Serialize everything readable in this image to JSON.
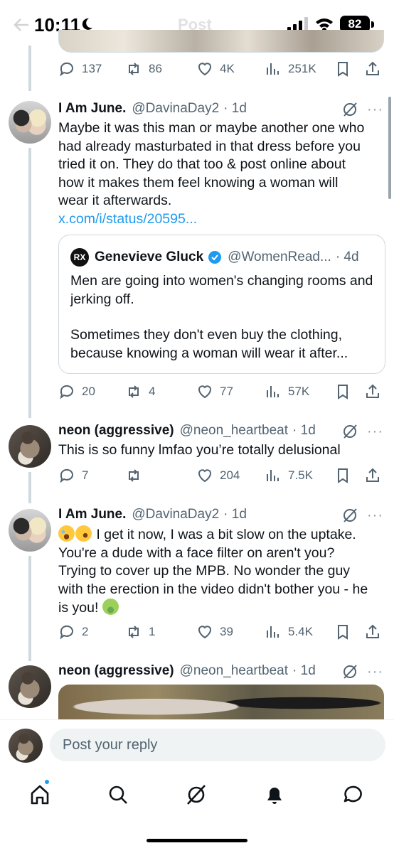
{
  "status_bar": {
    "time": "10:11",
    "battery": "82",
    "ghost_title": "Post"
  },
  "top_tweet_actions": {
    "replies": "137",
    "reposts": "86",
    "likes": "4K",
    "views": "251K"
  },
  "tweets": [
    {
      "name": "I Am June.",
      "handle": "@DavinaDay2",
      "time": "· 1d",
      "text": "Maybe it was this man or maybe another one who had already masturbated in that dress before you tried it on. They do that too & post online about how it makes them feel knowing a woman will wear it afterwards.",
      "link": "x.com/i/status/20595...",
      "quote": {
        "logo": "RX",
        "name": "Genevieve Gluck",
        "handle": "@WomenRead...",
        "time": "· 4d",
        "text1": "Men are going into women's changing rooms and jerking off.",
        "text2": "Sometimes they don't even buy the clothing, because knowing a woman will wear it after..."
      },
      "actions": {
        "replies": "20",
        "reposts": "4",
        "likes": "77",
        "views": "57K"
      }
    },
    {
      "name": "neon (aggressive)",
      "handle": "@neon_heartbeat",
      "time": "· 1d",
      "text": "This is so funny lmfao you’re totally delusional",
      "actions": {
        "replies": "7",
        "reposts": "",
        "likes": "204",
        "views": "7.5K"
      }
    },
    {
      "name": "I Am June.",
      "handle": "@DavinaDay2",
      "time": "· 1d",
      "text_a": " I get it now, I was a bit slow on the uptake. You're a dude with a face filter on aren't you? Trying to cover up the MPB. No wonder the guy with the erection in the video didn't bother you - he is you! ",
      "emojis": [
        "joy-emoji",
        "rofl-emoji",
        "nauseated-emoji"
      ],
      "actions": {
        "replies": "2",
        "reposts": "1",
        "likes": "39",
        "views": "5.4K"
      }
    },
    {
      "name": "neon (aggressive)",
      "handle": "@neon_heartbeat",
      "time": "· 1d"
    }
  ],
  "reply_bar": {
    "placeholder": "Post your reply"
  },
  "icons": [
    "home-icon",
    "search-icon",
    "grok-icon",
    "bell-icon",
    "messages-icon"
  ],
  "colors": {
    "accent": "#1d9bf0",
    "muted": "#536471",
    "text": "#0f1419"
  }
}
